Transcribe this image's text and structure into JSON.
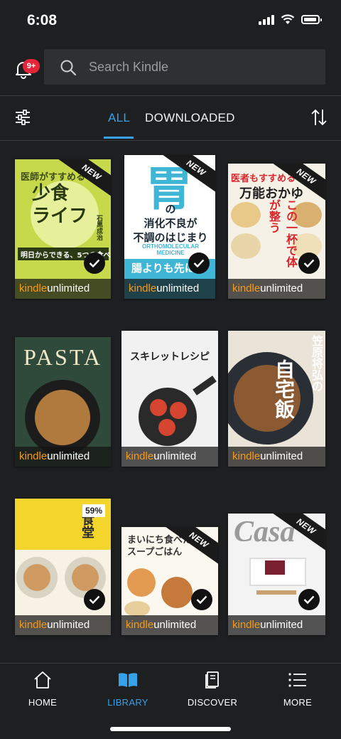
{
  "status": {
    "time": "6:08"
  },
  "header": {
    "notification_count": "9+",
    "search_placeholder": "Search Kindle"
  },
  "tabs": [
    {
      "label": "ALL",
      "active": true
    },
    {
      "label": "DOWNLOADED",
      "active": false
    }
  ],
  "kindle_unlimited": {
    "part1": "kindle",
    "part2": "unlimited"
  },
  "books": [
    {
      "title_main": "少食\nライフ",
      "title_top": "医師がすすめる",
      "author": "石黒成治",
      "subtitle": "明日からできる、5つの食べ方",
      "new_label": "NEW",
      "downloaded": true,
      "bg": "#c6d94a"
    },
    {
      "title_main": "胃",
      "title_top": "の\n消化不良が\n不調のはじまり",
      "subtitle": "ORTHOMOLECULAR MEDICINE",
      "extra": "腸よりも先に",
      "new_label": "NEW",
      "downloaded": true,
      "bg": "#ffffff"
    },
    {
      "title_top": "医者もすすめる",
      "title_main": "万能おかゆ",
      "subtitle": "この一杯で体が整う",
      "new_label": "NEW",
      "downloaded": true,
      "bg": "#f5f1e6"
    },
    {
      "title_main": "PASTA",
      "downloaded": false,
      "bg": "#2f4a3a"
    },
    {
      "title_main": "スキレットレシピ",
      "downloaded": false,
      "bg": "#f1f1f1"
    },
    {
      "title_main": "自宅飯",
      "title_top": "笠原将弘の",
      "downloaded": false,
      "bg": "#e9e3d8"
    },
    {
      "title_main": "食堂",
      "progress": "59%",
      "downloaded": true,
      "bg": "#f4d52c"
    },
    {
      "title_main": "まいにち食べたい\nスープごはん",
      "new_label": "NEW",
      "downloaded": true,
      "bg": "#fbf8f0"
    },
    {
      "title_main": "Casa",
      "new_label": "NEW",
      "downloaded": true,
      "bg": "#f3f3f3"
    }
  ],
  "nav": [
    {
      "label": "HOME",
      "icon": "home-icon",
      "active": false
    },
    {
      "label": "LIBRARY",
      "icon": "library-icon",
      "active": true
    },
    {
      "label": "DISCOVER",
      "icon": "discover-icon",
      "active": false
    },
    {
      "label": "MORE",
      "icon": "more-icon",
      "active": false
    }
  ],
  "colors": {
    "accent": "#37a1e8",
    "badge": "#e3263a",
    "kindle_orange": "#f39a1e",
    "background": "#1e1f21"
  }
}
